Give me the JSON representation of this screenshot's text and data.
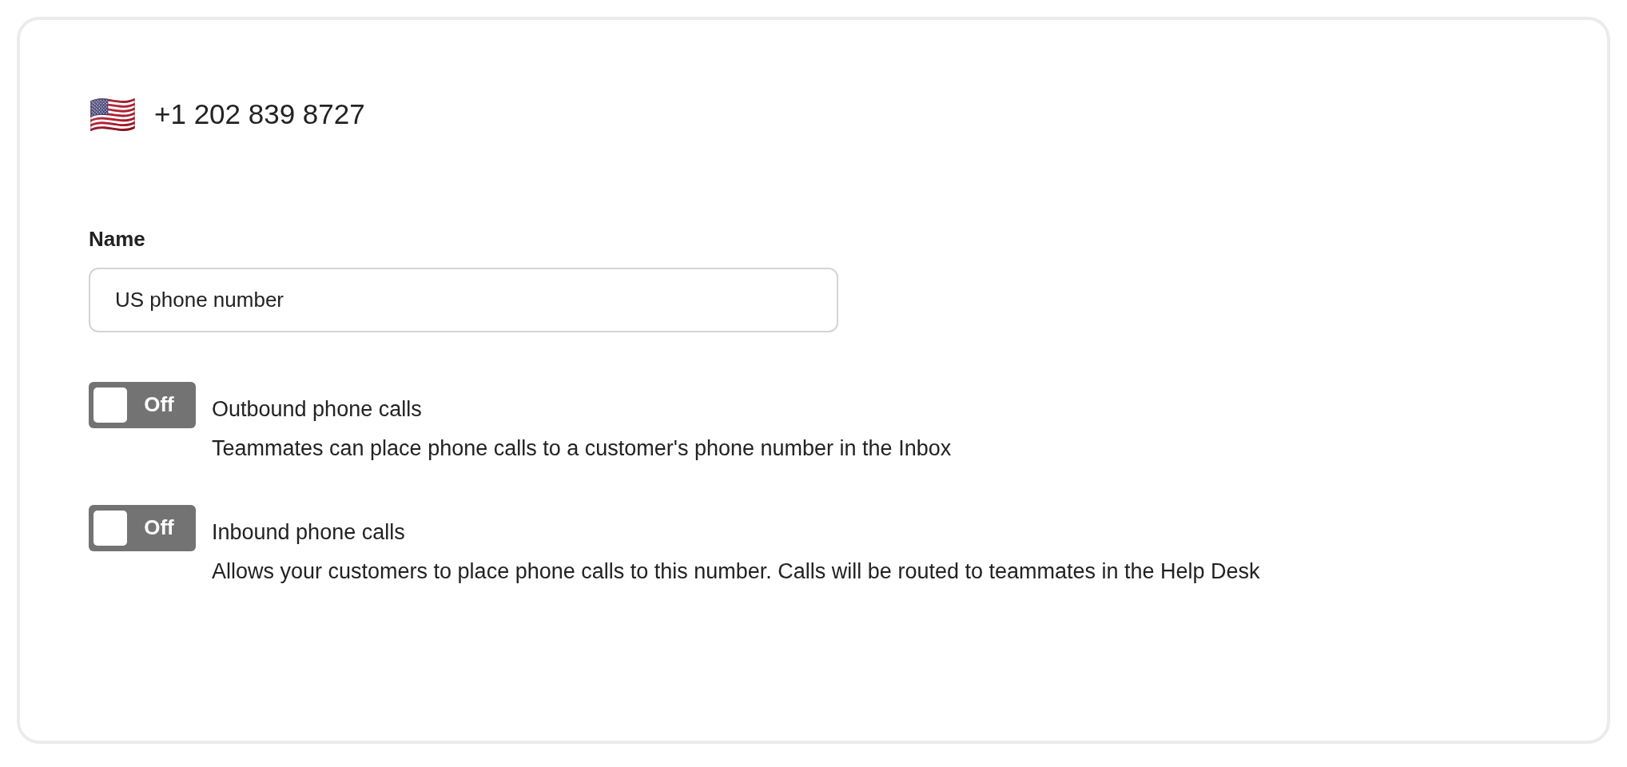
{
  "phone": {
    "flag": "🇺🇸",
    "number": "+1 202 839 8727"
  },
  "name_field": {
    "label": "Name",
    "value": "US phone number"
  },
  "settings": [
    {
      "title": "Outbound phone calls",
      "description": "Teammates can place phone calls to a customer's phone number in the Inbox",
      "toggle": {
        "on": false,
        "label": "Off"
      }
    },
    {
      "title": "Inbound phone calls",
      "description": "Allows your customers to place phone calls to this number. Calls will be routed to teammates in the Help Desk",
      "toggle": {
        "on": false,
        "label": "Off"
      }
    }
  ]
}
